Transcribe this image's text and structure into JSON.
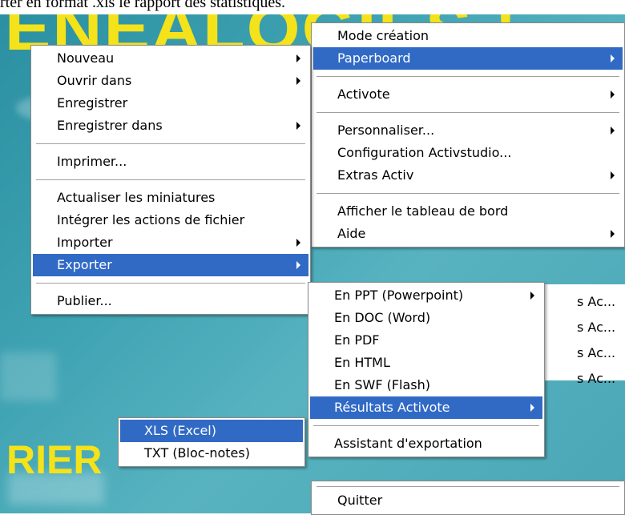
{
  "background": {
    "doc_caption": "rter en format .xls le rapport des statistiques.",
    "banner_text": "ENEALOGIES !",
    "word_rier": "RIER",
    "right_fragments": [
      "s Ac...",
      "s Ac...",
      "s Ac...",
      "s Ac..."
    ],
    "colors": {
      "app_bg": "#3fa3b3",
      "banner_yellow": "#f4e21a",
      "menu_highlight": "#316ac5"
    }
  },
  "file_menu": {
    "nouveau": "Nouveau",
    "ouvrir_dans": "Ouvrir dans",
    "enregistrer": "Enregistrer",
    "enregistrer_dans": "Enregistrer dans",
    "imprimer": "Imprimer...",
    "actualiser": "Actualiser les miniatures",
    "integrer": "Intégrer les actions de fichier",
    "importer": "Importer",
    "exporter": "Exporter",
    "publier": "Publier..."
  },
  "main_menu": {
    "mode_creation": "Mode création",
    "paperboard": "Paperboard",
    "activote": "Activote",
    "personnaliser": "Personnaliser...",
    "configuration": "Configuration Activstudio...",
    "extras": "Extras Activ",
    "tableau_de_bord": "Afficher le tableau de bord",
    "aide": "Aide",
    "quitter": "Quitter"
  },
  "export_menu": {
    "ppt": "En PPT (Powerpoint)",
    "doc": "En DOC (Word)",
    "pdf": "En PDF",
    "html": "En HTML",
    "swf": "En SWF (Flash)",
    "resultats": "Résultats Activote",
    "assistant": "Assistant d'exportation"
  },
  "activote_menu": {
    "xls": "XLS (Excel)",
    "txt": "TXT (Bloc-notes)"
  }
}
